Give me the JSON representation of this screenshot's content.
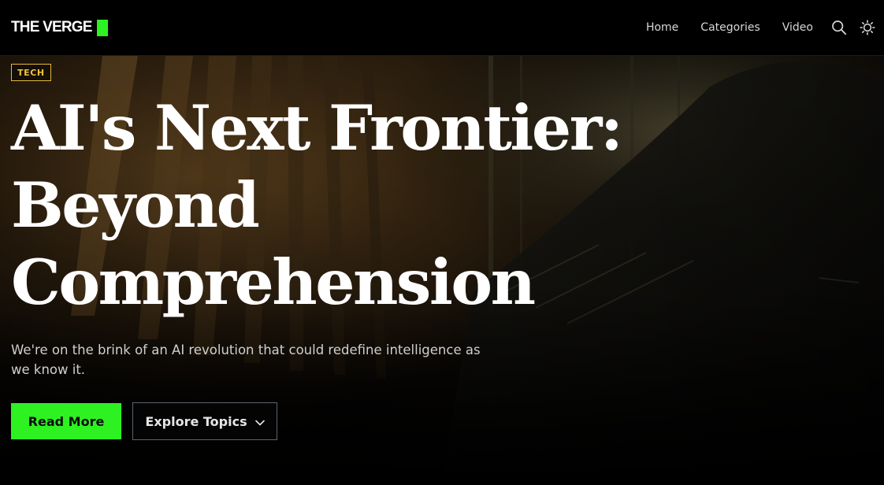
{
  "header": {
    "logo_text": "THE VERGE",
    "nav": [
      {
        "label": "Home"
      },
      {
        "label": "Categories"
      },
      {
        "label": "Video"
      }
    ],
    "icons": [
      "search-icon",
      "theme-toggle-icon"
    ]
  },
  "hero": {
    "tag": "TECH",
    "headline": [
      "AI's Next Frontier:",
      "Beyond",
      "Comprehension"
    ],
    "subtitle": "We're on the brink of an AI revolution that could redefine intelligence as we know it.",
    "primary_button": "Read More",
    "secondary_button": "Explore Topics",
    "secondary_button_icon": "chevron-down-icon"
  },
  "colors": {
    "accent": "#2ef121",
    "tag": "#f0c23e",
    "background": "#000000"
  }
}
